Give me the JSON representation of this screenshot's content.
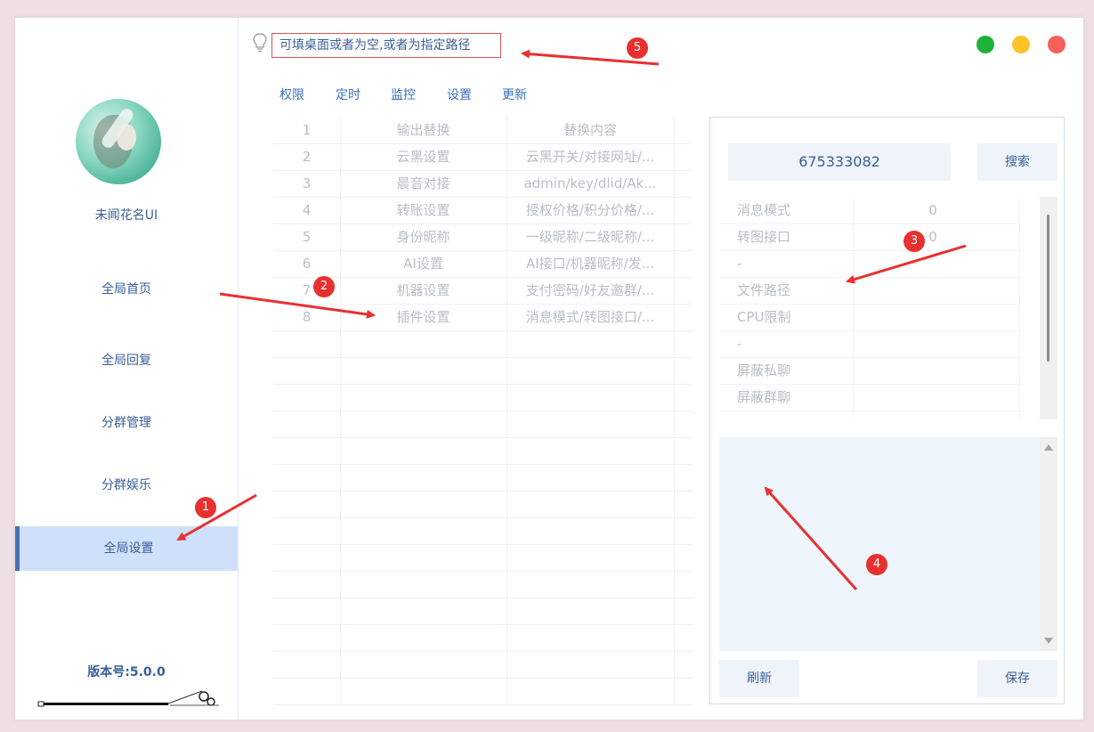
{
  "sidebar": {
    "user_name": "未闻花名UI",
    "nav": [
      {
        "label": "全局首页"
      },
      {
        "label": "全局回复"
      },
      {
        "label": "分群管理"
      },
      {
        "label": "分群娱乐"
      },
      {
        "label": "全局设置",
        "active": true
      }
    ],
    "version_label": "版本号:",
    "version_value": "5.0.0"
  },
  "topbar": {
    "path_placeholder": "可填桌面或者为空,或者为指定路径",
    "window_buttons": [
      {
        "name": "maximize",
        "color": "#1fb13a"
      },
      {
        "name": "minimize",
        "color": "#ffc329"
      },
      {
        "name": "close",
        "color": "#f5615c"
      }
    ]
  },
  "tabs": [
    "权限",
    "定时",
    "监控",
    "设置",
    "更新"
  ],
  "replace_table": {
    "rows": [
      {
        "num": "1",
        "name": "输出替换",
        "content": "替换内容"
      },
      {
        "num": "2",
        "name": "云黑设置",
        "content": "云黑开关/对接网址/..."
      },
      {
        "num": "3",
        "name": "晨音对接",
        "content": "admin/key/dlid/Ak..."
      },
      {
        "num": "4",
        "name": "转账设置",
        "content": "授权价格/积分价格/..."
      },
      {
        "num": "5",
        "name": "身份昵称",
        "content": "一级昵称/二级昵称/..."
      },
      {
        "num": "6",
        "name": "AI设置",
        "content": "AI接口/机器昵称/发..."
      },
      {
        "num": "7",
        "name": "机器设置",
        "content": "支付密码/好友邀群/..."
      },
      {
        "num": "8",
        "name": "插件设置",
        "content": "消息模式/转图接口/..."
      }
    ]
  },
  "right_panel": {
    "qq_value": "675333082",
    "search_label": "搜索",
    "settings": [
      {
        "key": "消息模式",
        "value": "0"
      },
      {
        "key": "转图接口",
        "value": "0"
      },
      {
        "key": "-",
        "value": ""
      },
      {
        "key": "文件路径",
        "value": ""
      },
      {
        "key": "CPU限制",
        "value": ""
      },
      {
        "key": "-",
        "value": ""
      },
      {
        "key": "屏蔽私聊",
        "value": ""
      },
      {
        "key": "屏蔽群聊",
        "value": ""
      }
    ],
    "refresh_label": "刷新",
    "save_label": "保存"
  },
  "annotations": [
    "1",
    "2",
    "3",
    "4",
    "5"
  ],
  "accent_colors": {
    "primary": "#3a6fb8",
    "active_nav_bg": "#cfe0fb",
    "annotation": "#e8302f"
  }
}
